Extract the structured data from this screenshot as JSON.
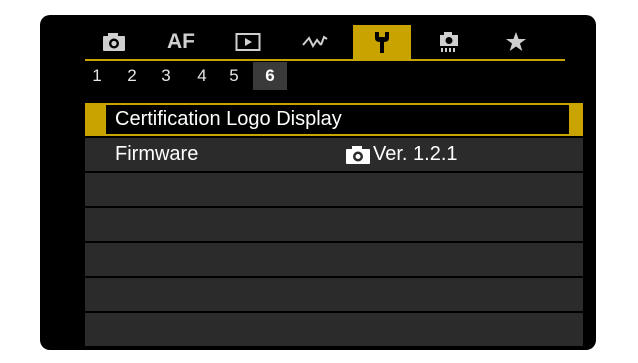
{
  "tabs": [
    {
      "name": "shooting",
      "icon": "camera-icon"
    },
    {
      "name": "af",
      "label": "AF"
    },
    {
      "name": "playback",
      "icon": "play-icon"
    },
    {
      "name": "custom-wireless",
      "icon": "wireless-icon"
    },
    {
      "name": "setup",
      "icon": "wrench-icon",
      "active": true
    },
    {
      "name": "custom-functions",
      "icon": "custom-camera-icon"
    },
    {
      "name": "my-menu",
      "icon": "star-icon"
    }
  ],
  "pages": [
    "1",
    "2",
    "3",
    "4",
    "5",
    "6"
  ],
  "active_page": "6",
  "menu": {
    "items": [
      {
        "label": "Certification Logo Display",
        "value": "",
        "selected": true
      },
      {
        "label": "Firmware",
        "value": "Ver. 1.2.1",
        "value_icon": "camera-icon"
      }
    ]
  },
  "colors": {
    "accent": "#c9a300",
    "row": "#2b2b2b",
    "background": "#000000"
  }
}
